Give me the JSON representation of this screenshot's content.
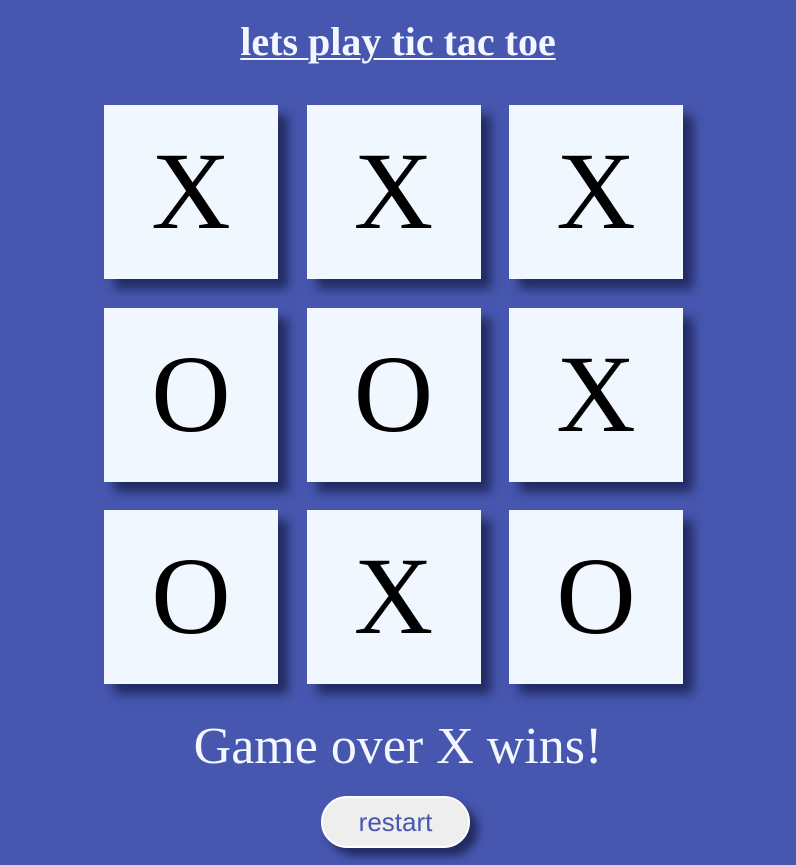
{
  "header": {
    "title": "lets play tic tac toe"
  },
  "board": {
    "cells": [
      [
        "X",
        "X",
        "X"
      ],
      [
        "O",
        "O",
        "X"
      ],
      [
        "O",
        "X",
        "O"
      ]
    ]
  },
  "status": {
    "message": "Game over X wins!"
  },
  "controls": {
    "restart_label": "restart"
  },
  "colors": {
    "background": "#4757b0",
    "cell": "#f0f7ff",
    "text_light": "#f3f7ff",
    "mark": "#000000",
    "button_bg": "#eeeeee",
    "button_text": "#4757b0"
  }
}
